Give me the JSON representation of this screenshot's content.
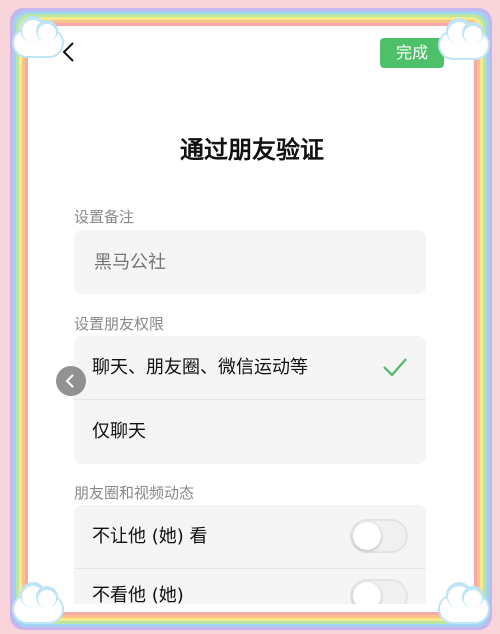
{
  "header": {
    "back_icon": "chevron-left-icon",
    "done_label": "完成"
  },
  "page": {
    "title": "通过朋友验证"
  },
  "remark": {
    "label": "设置备注",
    "placeholder": "黑马公社"
  },
  "permissions": {
    "label": "设置朋友权限",
    "options": [
      {
        "label": "聊天、朋友圈、微信运动等",
        "selected": true
      },
      {
        "label": "仅聊天",
        "selected": false
      }
    ]
  },
  "moments": {
    "label": "朋友圈和视频动态",
    "toggles": [
      {
        "label": "不让他 (她) 看",
        "on": false
      },
      {
        "label": "不看他 (她)",
        "on": false
      }
    ]
  },
  "colors": {
    "accent": "#4fc06a",
    "check": "#4fb86a"
  }
}
